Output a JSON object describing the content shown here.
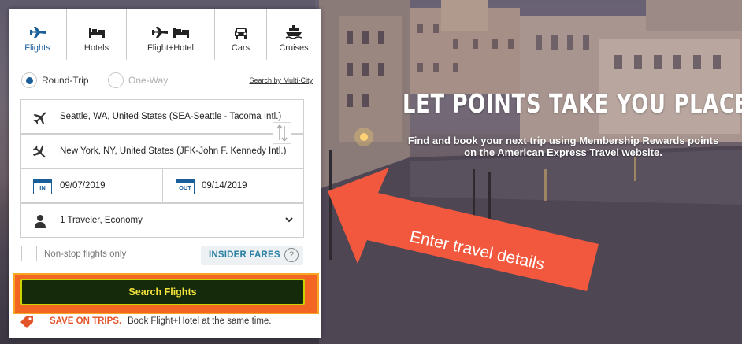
{
  "hero": {
    "title": "LET POINTS TAKE YOU PLACES",
    "subtitle_line1": "Find and book your next trip using Membership Rewards points",
    "subtitle_line2": "on the American Express Travel website."
  },
  "callout": {
    "text": "Enter travel details",
    "color": "#f2583e"
  },
  "tabs": [
    {
      "label": "Flights",
      "icon": "plane-icon",
      "active": true
    },
    {
      "label": "Hotels",
      "icon": "bed-icon",
      "active": false
    },
    {
      "label": "Flight+Hotel",
      "icon": "plane-bed-icon",
      "active": false
    },
    {
      "label": "Cars",
      "icon": "car-icon",
      "active": false
    },
    {
      "label": "Cruises",
      "icon": "ship-icon",
      "active": false
    }
  ],
  "trip_type": {
    "round_trip": "Round-Trip",
    "one_way": "One-Way",
    "selected": "Round-Trip",
    "multi_city_link": "Search by Multi-City"
  },
  "origin": {
    "value": "Seattle, WA, United States (SEA-Seattle - Tacoma Intl.)"
  },
  "destination": {
    "value": "New York, NY, United States (JFK-John F. Kennedy Intl.)"
  },
  "dates": {
    "in_badge": "IN",
    "out_badge": "OUT",
    "depart": "09/07/2019",
    "return": "09/14/2019"
  },
  "travelers": {
    "value": "1 Traveler, Economy"
  },
  "options": {
    "nonstop_label": "Non-stop flights only",
    "nonstop_checked": false,
    "insider_fares": "INSIDER FARES",
    "help": "?"
  },
  "search_button": {
    "label": "Search Flights"
  },
  "promo": {
    "strong": "SAVE ON TRIPS.",
    "rest": "Book Flight+Hotel at the same time."
  },
  "colors": {
    "accent_blue": "#1a5e9a",
    "insider_teal": "#2a7fa3",
    "search_bg": "#152a0b",
    "search_text": "#f3e33a",
    "highlight_orange": "#f26522",
    "promo_red": "#e2552b"
  }
}
